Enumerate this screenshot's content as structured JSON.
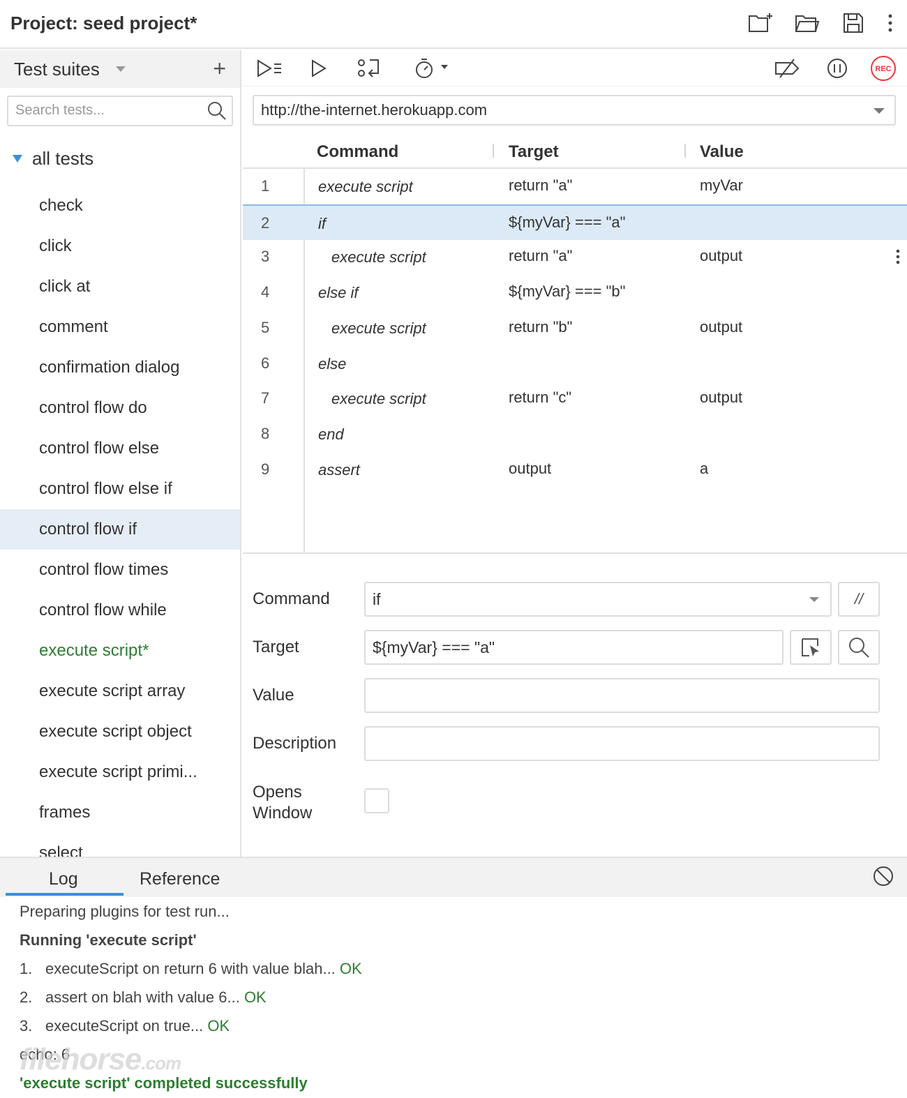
{
  "header": {
    "title": "Project:  seed project*",
    "icons": [
      "new-project-icon",
      "open-project-icon",
      "save-icon",
      "more-icon"
    ]
  },
  "sidebar": {
    "title": "Test suites",
    "add_label": "+",
    "search_placeholder": "Search tests...",
    "root_label": "all tests",
    "tests": [
      {
        "label": "check"
      },
      {
        "label": "click"
      },
      {
        "label": "click at"
      },
      {
        "label": "comment"
      },
      {
        "label": "confirmation dialog"
      },
      {
        "label": "control flow do"
      },
      {
        "label": "control flow else"
      },
      {
        "label": "control flow else if"
      },
      {
        "label": "control flow if",
        "active": true
      },
      {
        "label": "control flow times"
      },
      {
        "label": "control flow while"
      },
      {
        "label": "execute script*",
        "modified": true
      },
      {
        "label": "execute script array"
      },
      {
        "label": "execute script object"
      },
      {
        "label": "execute script primi..."
      },
      {
        "label": "frames"
      },
      {
        "label": "select"
      }
    ]
  },
  "toolbar": {
    "left_icons": [
      "run-all-icon",
      "run-icon",
      "step-icon",
      "speed-icon"
    ],
    "right_icons": [
      "disable-breakpoints-icon",
      "pause-icon",
      "record-icon"
    ],
    "rec_label": "REC",
    "rec_color": "#e53935"
  },
  "url": "http://the-internet.herokuapp.com",
  "grid": {
    "headers": {
      "command": "Command",
      "target": "Target",
      "value": "Value"
    },
    "rows": [
      {
        "num": "1",
        "command": "execute script",
        "indent": 0,
        "target": "return \"a\"",
        "value": "myVar"
      },
      {
        "num": "2",
        "command": "if",
        "indent": 0,
        "target": "${myVar} === \"a\"",
        "value": "",
        "selected": true
      },
      {
        "num": "3",
        "command": "execute script",
        "indent": 1,
        "target": "return \"a\"",
        "value": "output"
      },
      {
        "num": "4",
        "command": "else if",
        "indent": 0,
        "target": "${myVar} === \"b\"",
        "value": ""
      },
      {
        "num": "5",
        "command": "execute script",
        "indent": 1,
        "target": "return \"b\"",
        "value": "output"
      },
      {
        "num": "6",
        "command": "else",
        "indent": 0,
        "target": "",
        "value": ""
      },
      {
        "num": "7",
        "command": "execute script",
        "indent": 1,
        "target": "return \"c\"",
        "value": "output"
      },
      {
        "num": "8",
        "command": "end",
        "indent": 0,
        "target": "",
        "value": ""
      },
      {
        "num": "9",
        "command": "assert",
        "indent": 0,
        "target": "output",
        "value": "a"
      }
    ]
  },
  "editor": {
    "command_label": "Command",
    "command_value": "if",
    "comment_toggle": "//",
    "target_label": "Target",
    "target_value": "${myVar} === \"a\"",
    "value_label": "Value",
    "value_value": "",
    "description_label": "Description",
    "description_value": "",
    "opens_window_label_1": "Opens",
    "opens_window_label_2": "Window"
  },
  "bottom": {
    "tabs": [
      "Log",
      "Reference"
    ],
    "active_tab": "Log",
    "log": {
      "preparing": "Preparing plugins for test run...",
      "running": "Running 'execute script'",
      "steps": [
        {
          "n": "1.",
          "text": "executeScript on return 6 with value blah... ",
          "status": "OK"
        },
        {
          "n": "2.",
          "text": "assert on blah with value 6... ",
          "status": "OK"
        },
        {
          "n": "3.",
          "text": "executeScript on true... ",
          "status": "OK"
        }
      ],
      "echo": "echo: 6",
      "completed": "'execute script' completed successfully"
    },
    "watermark_main": "filehorse",
    "watermark_suffix": ".com"
  },
  "colors": {
    "accent": "#3b8fd9",
    "selected_row": "#dce9f7",
    "ok_green": "#2e7d32",
    "record_red": "#e53935"
  }
}
